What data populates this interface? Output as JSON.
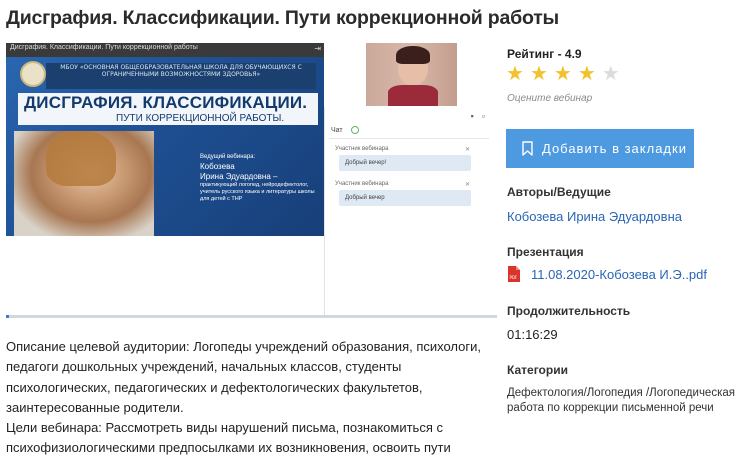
{
  "page": {
    "title": "Дисграфия. Классификации. Пути коррекционной работы"
  },
  "player": {
    "slide": {
      "topbar_text": "Дисграфия. Классификации. Пути коррекционной работы",
      "band_text": "МБОУ «ОСНОВНАЯ ОБЩЕОБРАЗОВАТЕЛЬНАЯ ШКОЛА ДЛЯ ОБУЧАЮЩИХСЯ С ОГРАНИЧЕННЫМИ ВОЗМОЖНОСТЯМИ ЗДОРОВЬЯ»",
      "headline": "ДИСГРАФИЯ. КЛАССИФИКАЦИИ.",
      "subheadline": "ПУТИ КОРРЕКЦИОННОЙ РАБОТЫ.",
      "presenter_label": "Ведущий вебинара:",
      "presenter_surname": "Кобозева",
      "presenter_name": "Ирина Эдуардовна –",
      "presenter_desc": "практикующий логопед, нейродефектолог, учитель русского языка и литературы школы для детей с ТНР"
    },
    "chat": {
      "label": "Чат",
      "messages": [
        {
          "author": "Участник вебинара",
          "text": "Добрый вечер!"
        },
        {
          "author": "Участник вебинара",
          "text": "Добрый вечер"
        }
      ]
    },
    "progress_fraction": 0.006
  },
  "description": {
    "audience": "Описание целевой аудитории: Логопеды учреждений образования, психологи, педагоги дошкольных учреждений, начальных классов, студенты психологических, педагогических и дефектологических факультетов, заинтересованные родители.",
    "goals": "Цели вебинара: Рассмотреть виды нарушений письма, познакомиться с психофизиологическими предпосылками их возникновения, освоить пути коррекции."
  },
  "sidebar": {
    "rating_label": "Рейтинг - 4.9",
    "rating_value": 4.9,
    "stars_filled": 4,
    "stars_total": 5,
    "rate_hint": "Оцените вебинар",
    "bookmark_label": "Добавить в закладки",
    "authors_title": "Авторы/Ведущие",
    "author_name": "Кобозева Ирина Эдуардовна",
    "presentation_title": "Презентация",
    "presentation_file": "11.08.2020-Кобозева И.Э..pdf",
    "duration_title": "Продолжительность",
    "duration_value": "01:16:29",
    "categories_title": "Категории",
    "category_value": "Дефектология/Логопедия /Логопедическая работа по коррекции письменной речи"
  },
  "colors": {
    "accent": "#4d9ae1",
    "link": "#2a66b4",
    "star_filled": "#f2c12e",
    "star_empty": "#dcdcdc",
    "pdf_red": "#d9352b"
  },
  "icons": {
    "bookmark": "bookmark-icon",
    "pdf": "pdf-file-icon",
    "star": "star-icon",
    "exit": "exit-fullscreen-icon"
  }
}
